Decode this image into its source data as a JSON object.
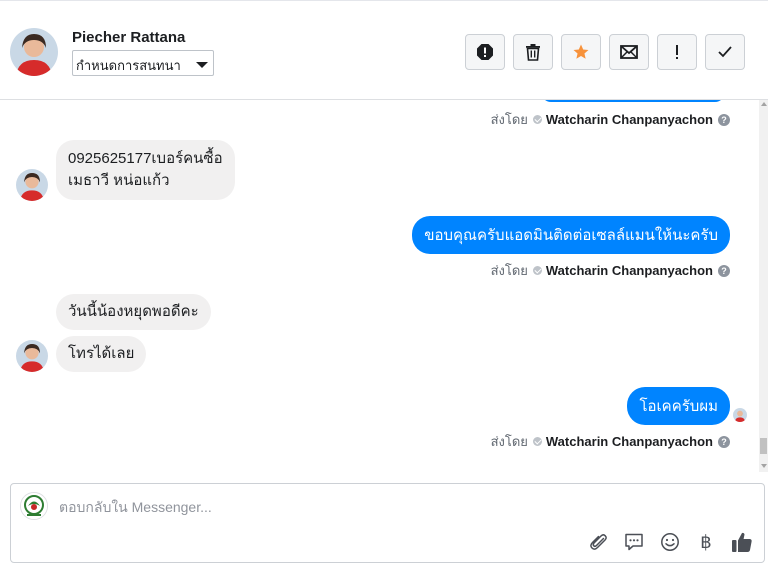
{
  "header": {
    "contact_name": "Piecher Rattana",
    "assign_label": "กำหนดการสนทนา"
  },
  "toolbar": {
    "icons": [
      "report-icon",
      "trash-icon",
      "star-icon",
      "envelope-icon",
      "exclamation-icon",
      "check-icon"
    ],
    "star_color": "#f7923b"
  },
  "thread": {
    "sent_by_prefix": "ส่งโดย",
    "agent_name": "Watcharin Chanpanyachon",
    "messages": [
      {
        "direction": "in",
        "lines": [
          "0925625177เบอร์คนซื้อ",
          "เมธาวี หน่อแก้ว"
        ]
      },
      {
        "direction": "out",
        "text": "ขอบคุณครับแอดมินติดต่อเซลล์แมนให้นะครับ"
      },
      {
        "direction": "in",
        "text": "วันนี้น้องหยุดพอดีคะ"
      },
      {
        "direction": "in",
        "text": "โทรได้เลย"
      },
      {
        "direction": "out",
        "text": "โอเคครับผม"
      }
    ]
  },
  "composer": {
    "placeholder": "ตอบกลับใน Messenger...",
    "icons": [
      "paperclip-icon",
      "saved-reply-icon",
      "emoji-icon",
      "baht-icon",
      "thumbs-up-icon"
    ],
    "baht_symbol": "฿"
  },
  "colors": {
    "outgoing_bubble": "#0084ff",
    "incoming_bubble": "#f1f0f0"
  }
}
